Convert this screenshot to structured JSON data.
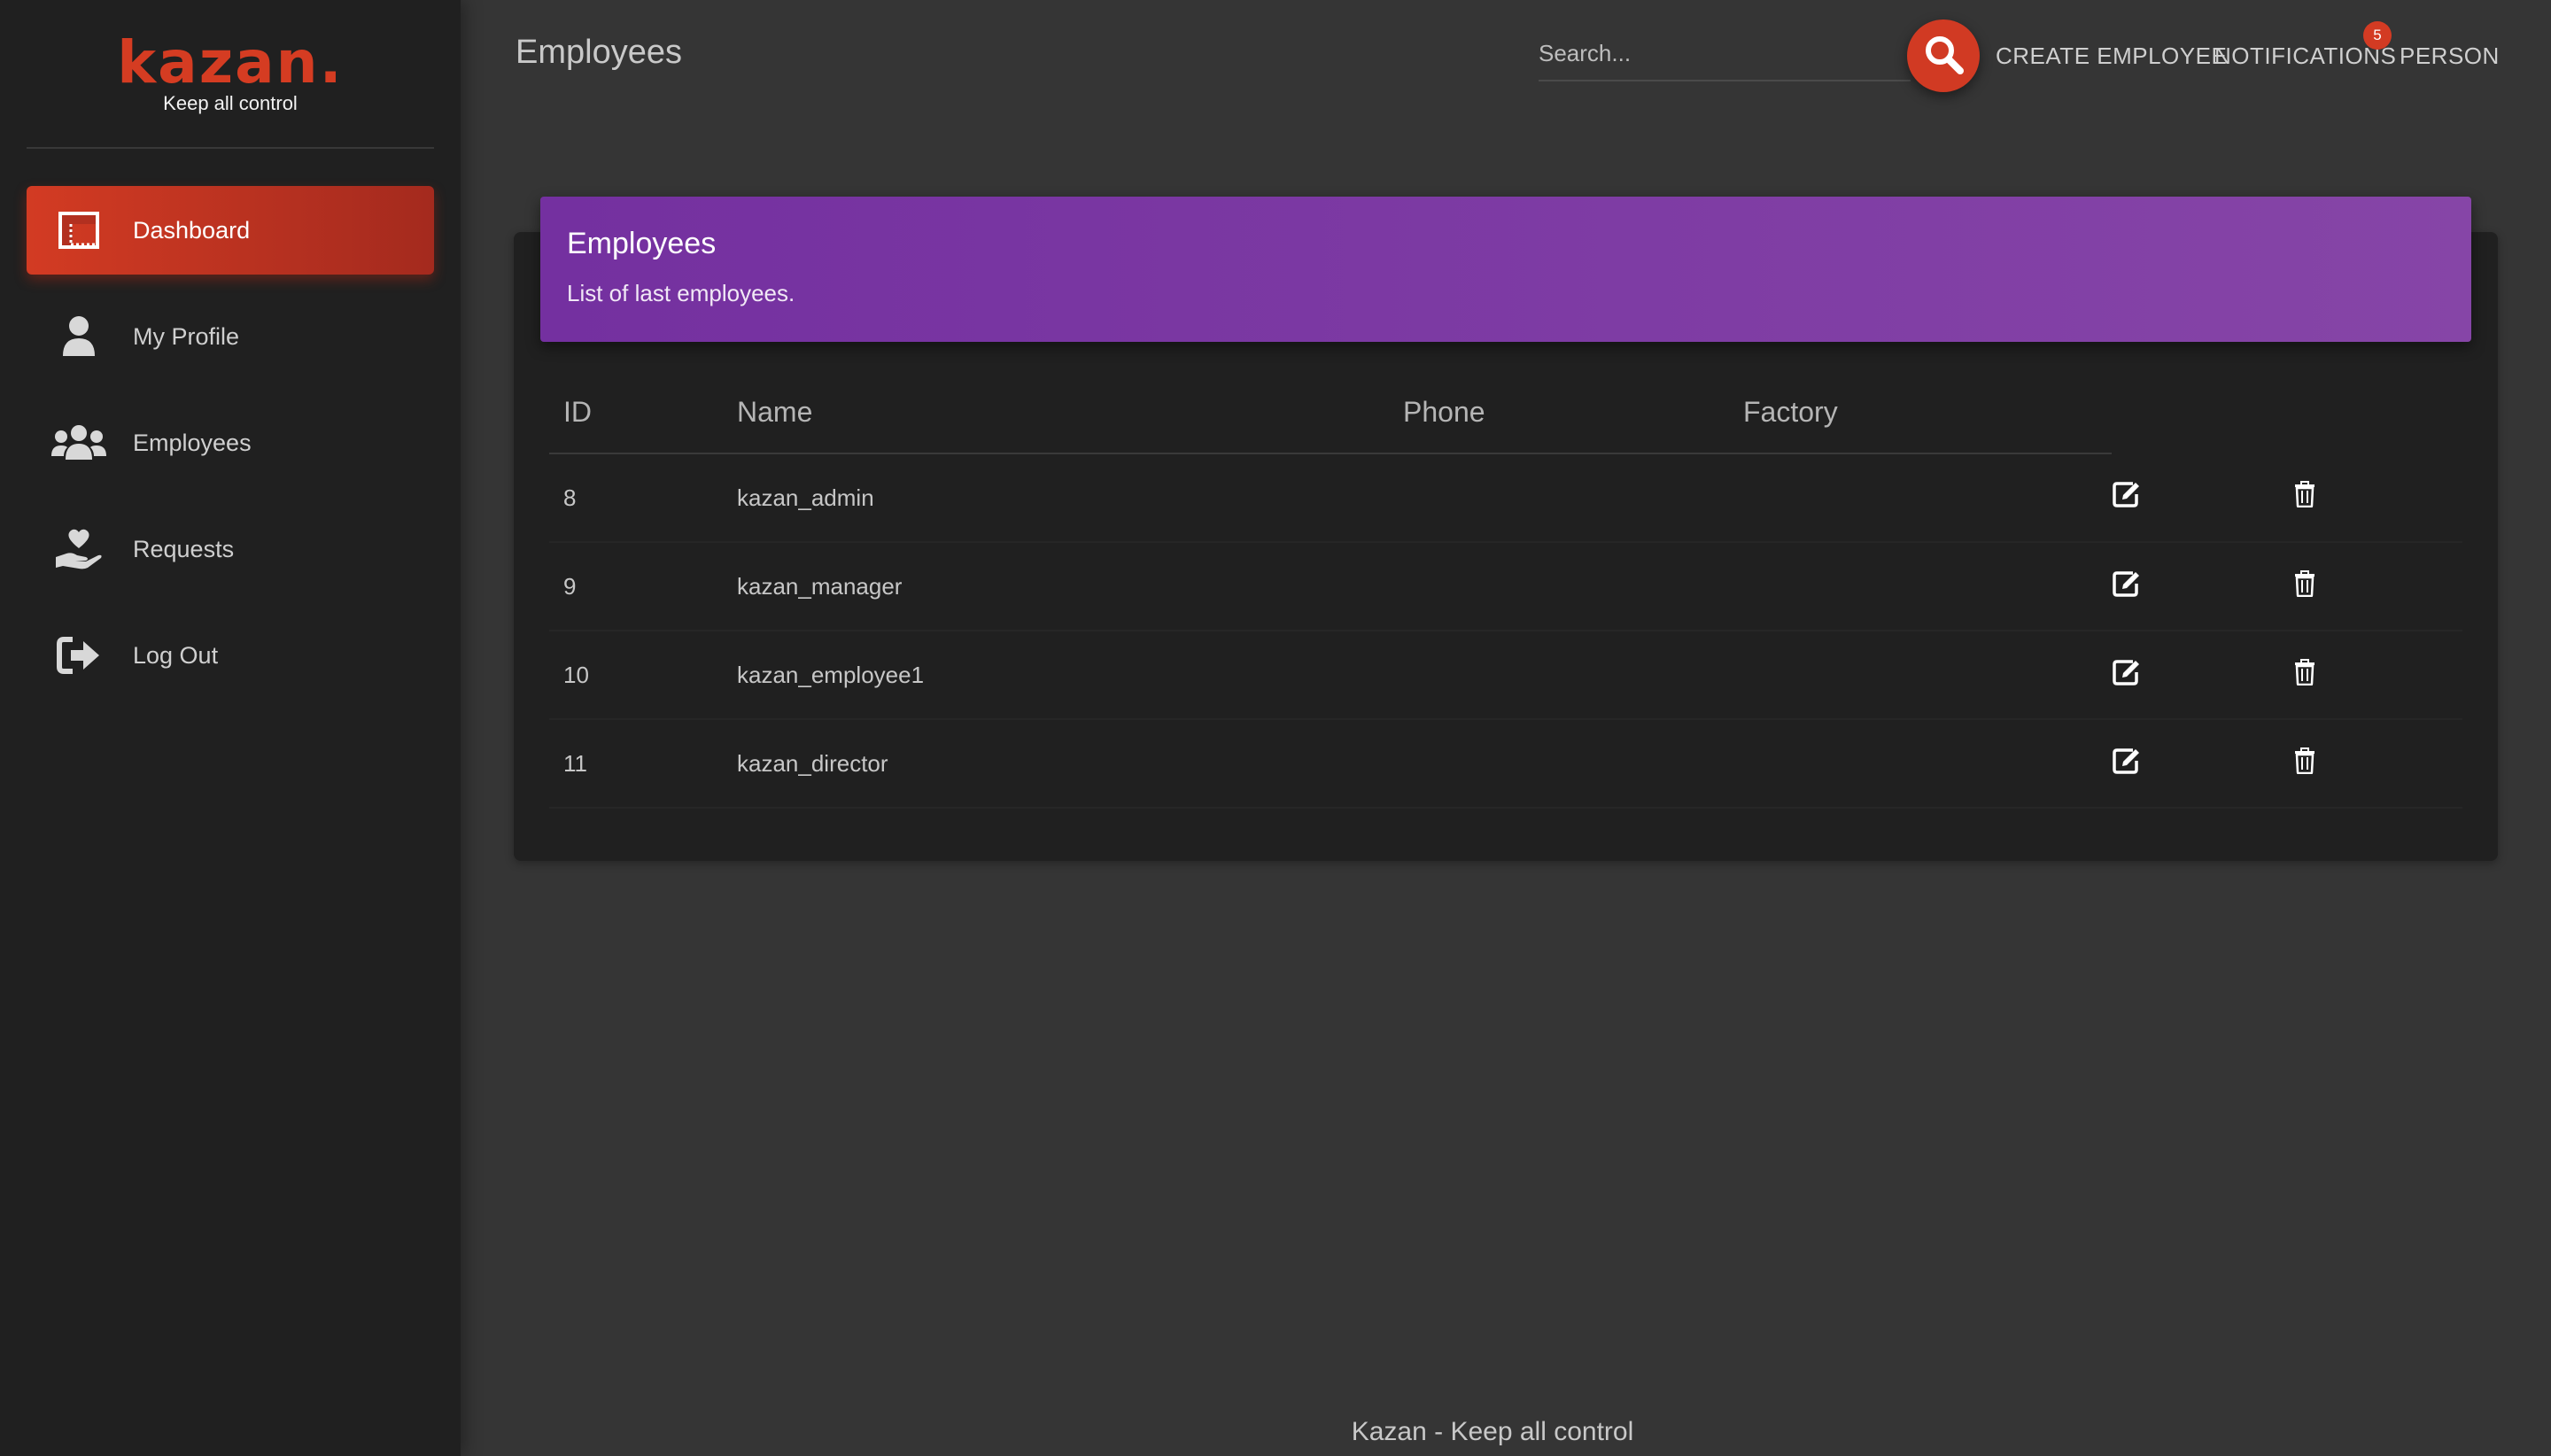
{
  "brand": {
    "name": "kazan.",
    "tagline": "Keep all control",
    "accent": "#d33b23"
  },
  "sidebar": {
    "items": [
      {
        "label": "Dashboard",
        "icon": "dashboard-icon",
        "active": true
      },
      {
        "label": "My Profile",
        "icon": "person-icon",
        "active": false
      },
      {
        "label": "Employees",
        "icon": "users-icon",
        "active": false
      },
      {
        "label": "Requests",
        "icon": "hand-heart-icon",
        "active": false
      },
      {
        "label": "Log Out",
        "icon": "logout-icon",
        "active": false
      }
    ]
  },
  "header": {
    "title": "Employees",
    "search_placeholder": "Search...",
    "create_label": "CREATE EMPLOYEE",
    "notifications_label": "NOTIFICATIONS",
    "notifications_count": "5",
    "person_label": "PERSON"
  },
  "card": {
    "title": "Employees",
    "subtitle": "List of last employees.",
    "header_color": "#7a35a3",
    "columns": [
      "ID",
      "Name",
      "Phone",
      "Factory"
    ],
    "rows": [
      {
        "id": "8",
        "name": "kazan_admin",
        "phone": "",
        "factory": ""
      },
      {
        "id": "9",
        "name": "kazan_manager",
        "phone": "",
        "factory": ""
      },
      {
        "id": "10",
        "name": "kazan_employee1",
        "phone": "",
        "factory": ""
      },
      {
        "id": "11",
        "name": "kazan_director",
        "phone": "",
        "factory": ""
      }
    ]
  },
  "footer": {
    "text": "Kazan - Keep all control"
  }
}
